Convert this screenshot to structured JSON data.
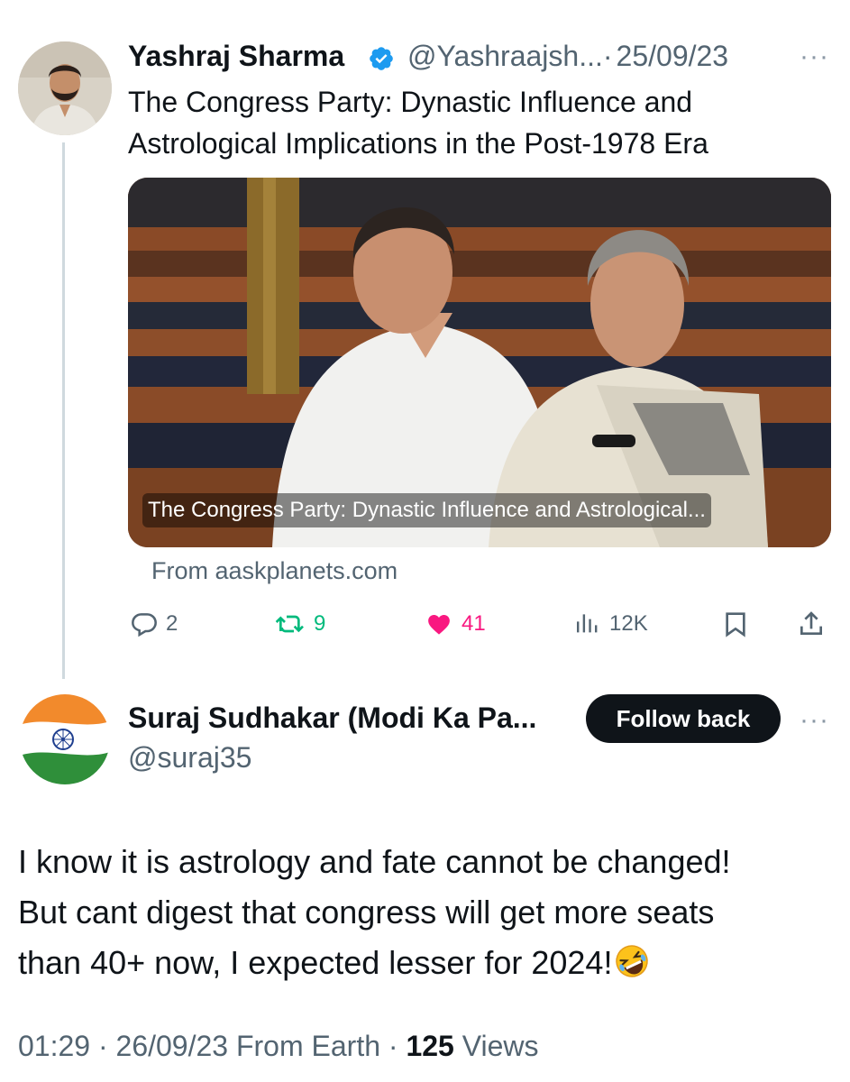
{
  "original_tweet": {
    "author_name": "Yashraj Sharma",
    "handle": "@Yashraajsh...",
    "separator": "·",
    "date": "25/09/23",
    "more_label": "···",
    "text_line1": "The Congress Party: Dynastic Influence and",
    "text_line2": "Astrological Implications in the Post-1978 Era",
    "card": {
      "caption": "The Congress Party: Dynastic Influence and Astrological...",
      "source": "From aaskplanets.com"
    },
    "actions": {
      "replies": "2",
      "retweets": "9",
      "likes": "41",
      "views": "12K"
    },
    "icons": [
      "verified-badge-icon",
      "reply-icon",
      "retweet-icon",
      "like-icon",
      "views-icon",
      "bookmark-icon",
      "share-icon"
    ]
  },
  "reply_tweet": {
    "author_name": "Suraj Sudhakar (Modi Ka Pa...",
    "handle": "@suraj35",
    "follow_label": "Follow back",
    "more_label": "···",
    "text_line1": "I know it is astrology and fate cannot be changed!",
    "text_line2": "But cant digest that congress will get more seats",
    "text_line3": "than 40+ now, I expected lesser for 2024!",
    "emoji": "rolling-on-floor-laughing-emoji",
    "meta": {
      "time": "01:29",
      "separator": "·",
      "date": "26/09/23",
      "source": "From Earth",
      "views_count": "125",
      "views_label": "Views"
    }
  },
  "colors": {
    "text": "#0f1419",
    "secondary": "#536471",
    "verified": "#1d9bf0",
    "retweet": "#00ba7c",
    "like": "#f91880",
    "thread_line": "#cfd9de"
  }
}
